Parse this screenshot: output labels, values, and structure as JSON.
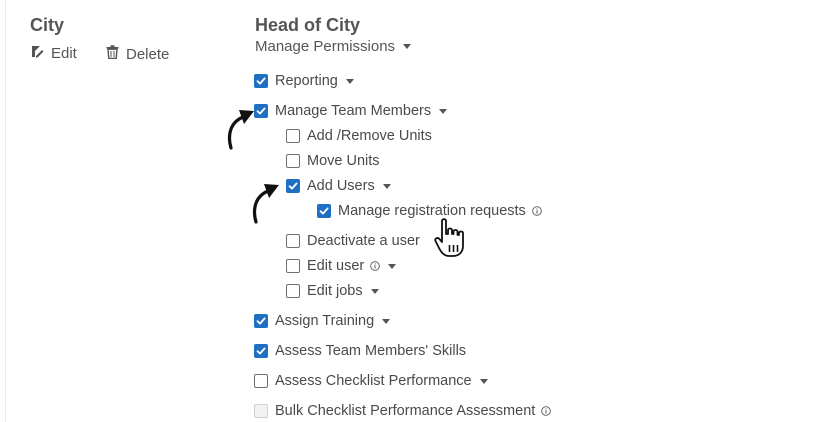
{
  "left": {
    "title": "City",
    "edit_label": "Edit",
    "delete_label": "Delete"
  },
  "right": {
    "title": "Head of City",
    "manage_permissions_label": "Manage Permissions"
  },
  "permissions": {
    "reporting": "Reporting",
    "manage_team_members": "Manage Team Members",
    "add_remove_units": "Add /Remove Units",
    "move_units": "Move Units",
    "add_users": "Add Users",
    "manage_registration_requests": "Manage registration requests",
    "deactivate_user": "Deactivate a user",
    "edit_user": "Edit user",
    "edit_jobs": "Edit jobs",
    "assign_training": "Assign Training",
    "assess_skills": "Assess Team Members' Skills",
    "assess_checklist": "Assess Checklist Performance",
    "bulk_checklist": "Bulk Checklist Performance Assessment"
  },
  "checked": {
    "reporting": true,
    "manage_team_members": true,
    "add_remove_units": false,
    "move_units": false,
    "add_users": true,
    "manage_registration_requests": true,
    "deactivate_user": false,
    "edit_user": false,
    "edit_jobs": false,
    "assign_training": true,
    "assess_skills": true,
    "assess_checklist": false,
    "bulk_checklist": false
  },
  "disabled": {
    "bulk_checklist": true
  },
  "colors": {
    "checkbox_checked": "#1f6fc5",
    "text": "#4a4a4a",
    "heading": "#555555"
  },
  "icons": [
    "edit-icon",
    "trash-icon",
    "caret-down-icon",
    "info-icon",
    "checkmark-icon",
    "curved-arrow-icon",
    "hand-pointer-icon"
  ]
}
